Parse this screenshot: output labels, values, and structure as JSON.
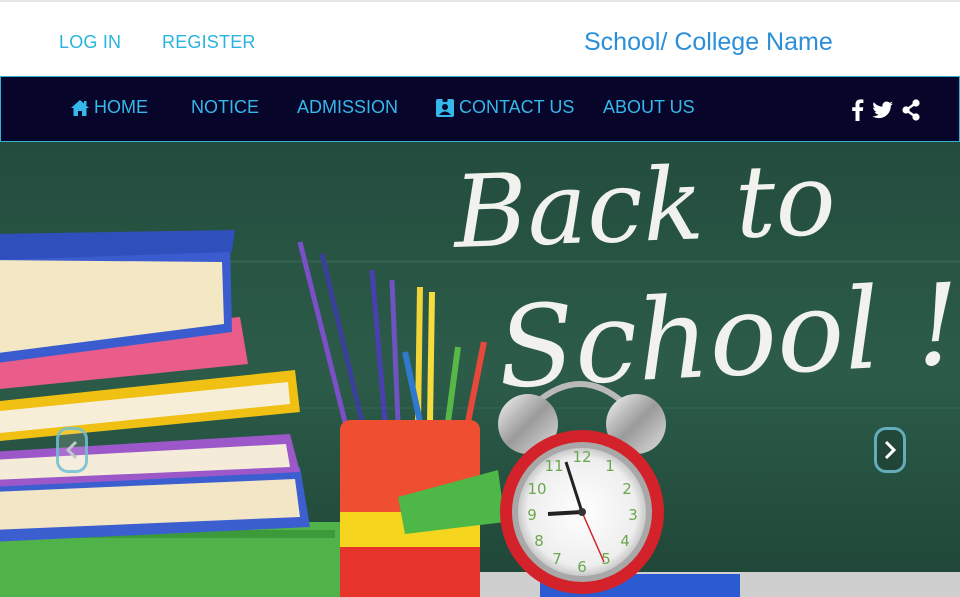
{
  "header": {
    "login_label": "LOG IN",
    "register_label": "REGISTER",
    "site_name": "School/ College Name"
  },
  "nav": {
    "home_label": "HOME",
    "notice_label": "NOTICE",
    "admission_label": "ADMISSION",
    "contact_label": "CONTACT US",
    "about_label": "ABOUT US",
    "social_icons": [
      "facebook-icon",
      "twitter-icon",
      "share-icon"
    ]
  },
  "hero": {
    "image_subject": "back to school chalkboard with books, pencil cup and alarm clock",
    "chalk_line_1": "Back to",
    "chalk_line_2": "School !",
    "carousel_prev_icon": "chevron-left-icon",
    "carousel_next_icon": "chevron-right-icon"
  },
  "colors": {
    "link_blue": "#2ab3e0",
    "site_name_blue": "#2a8fd8",
    "navbar_bg": "#07062a",
    "navbar_border": "#2fb3cf",
    "chalkboard_green": "#2b5a47"
  }
}
